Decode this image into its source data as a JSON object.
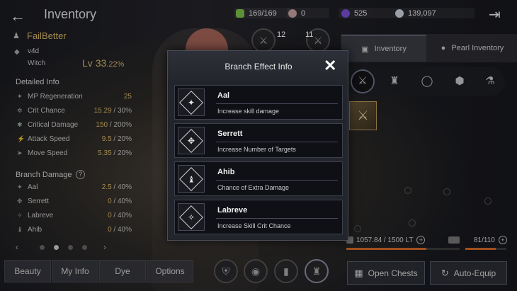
{
  "header": {
    "title": "Inventory",
    "resources": [
      {
        "icon": "energy-icon",
        "value": "169/169",
        "color": "#7cc24a"
      },
      {
        "icon": "pearl-icon",
        "value": "0",
        "color": "#c9a0a0"
      },
      {
        "icon": "purple-gem-icon",
        "value": "525",
        "color": "#7a4fd6"
      },
      {
        "icon": "silver-coin-icon",
        "value": "139,097",
        "color": "#cfd6e0"
      }
    ]
  },
  "character": {
    "name": "FailBetter",
    "guild": "v4d",
    "class": "Witch",
    "level_label": "Lv",
    "level": "33",
    "level_pct": ".22%"
  },
  "detailed_info": {
    "title": "Detailed Info",
    "stats": [
      {
        "label": "MP Regeneration",
        "value": "25",
        "max": ""
      },
      {
        "label": "Crit Chance",
        "value": "15.29",
        "max": " / 30%"
      },
      {
        "label": "Critical Damage",
        "value": "150",
        "max": " / 200%"
      },
      {
        "label": "Attack Speed",
        "value": "9.5",
        "max": " / 20%"
      },
      {
        "label": "Move Speed",
        "value": "5.35",
        "max": " / 20%"
      }
    ]
  },
  "branch_damage": {
    "title": "Branch Damage",
    "help": "?",
    "stats": [
      {
        "label": "Aal",
        "value": "2.5",
        "max": " / 40%"
      },
      {
        "label": "Serrett",
        "value": "0",
        "max": " / 40%"
      },
      {
        "label": "Labreve",
        "value": "0",
        "max": " / 40%"
      },
      {
        "label": "Ahib",
        "value": "0",
        "max": " / 40%"
      }
    ]
  },
  "pager": {
    "prev": "‹",
    "next": "›",
    "pages": 4,
    "active": 2
  },
  "bottom_tabs": [
    "Beauty",
    "My Info",
    "Dye",
    "Options"
  ],
  "inventory_tabs": [
    {
      "label": "Inventory",
      "icon": "bag-icon"
    },
    {
      "label": "Pearl Inventory",
      "icon": "pearl-icon"
    }
  ],
  "categories": [
    {
      "name": "weapon-category-icon",
      "glyph": "⚔"
    },
    {
      "name": "armor-category-icon",
      "glyph": "♜"
    },
    {
      "name": "accessory-category-icon",
      "glyph": "◯"
    },
    {
      "name": "gem-category-icon",
      "glyph": "⬢"
    },
    {
      "name": "potion-category-icon",
      "glyph": "⚗"
    }
  ],
  "inventory_status": {
    "weight": "1057.84 / 1500 LT",
    "weight_fraction": 0.705,
    "slots": "81/110",
    "slots_fraction": 0.736
  },
  "actions": {
    "open_chests": "Open Chests",
    "auto_equip": "Auto-Equip"
  },
  "modal": {
    "title": "Branch Effect Info",
    "close": "✕",
    "effects": [
      {
        "name": "Aal",
        "desc": "Increase skill damage",
        "glyph": "✦"
      },
      {
        "name": "Serrett",
        "desc": "Increase Number of Targets",
        "glyph": "✥"
      },
      {
        "name": "Ahib",
        "desc": "Chance of Extra Damage",
        "glyph": "♝"
      },
      {
        "name": "Labreve",
        "desc": "Increase Skill Crit Chance",
        "glyph": "✧"
      }
    ]
  },
  "equip_badges": [
    "12",
    "11"
  ]
}
